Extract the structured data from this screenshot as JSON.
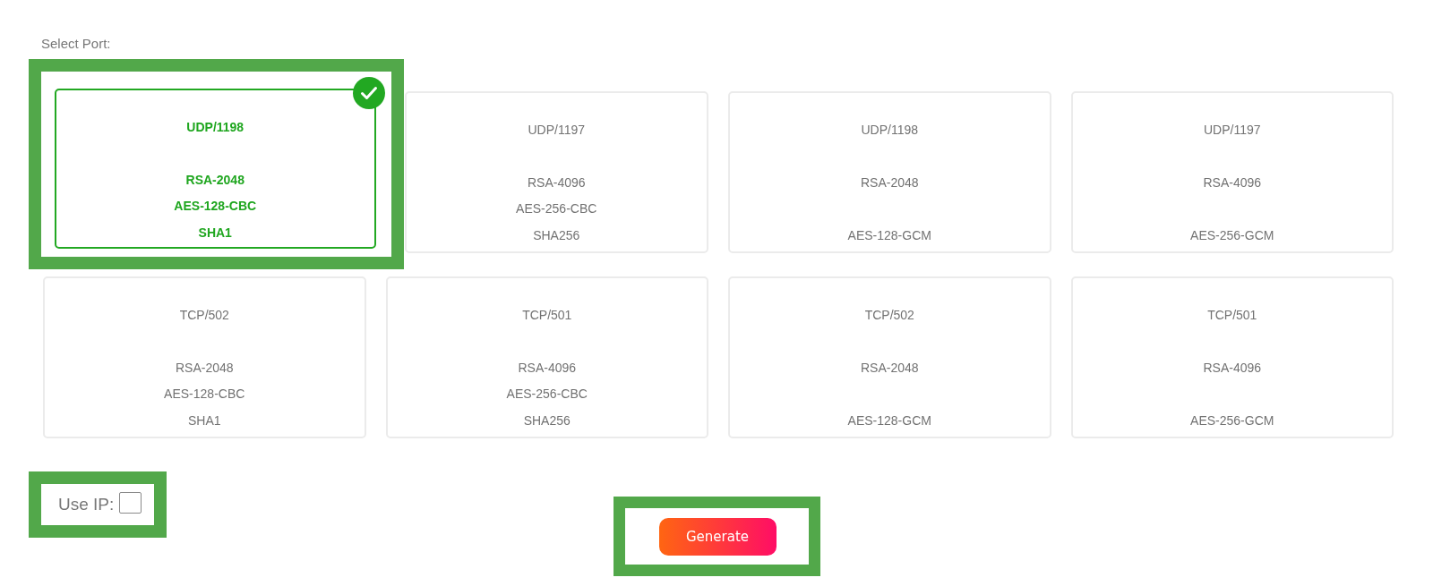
{
  "heading": "Select Port:",
  "ports": [
    {
      "port": "UDP/1198",
      "key": "RSA-2048",
      "cipher": "AES-128-CBC",
      "hash": "SHA1",
      "selected": true,
      "highlighted": true
    },
    {
      "port": "UDP/1197",
      "key": "RSA-4096",
      "cipher": "AES-256-CBC",
      "hash": "SHA256",
      "selected": false,
      "highlighted": false
    },
    {
      "port": "UDP/1198",
      "key": "RSA-2048",
      "cipher": "AES-128-GCM",
      "selected": false,
      "highlighted": false
    },
    {
      "port": "UDP/1197",
      "key": "RSA-4096",
      "cipher": "AES-256-GCM",
      "selected": false,
      "highlighted": false
    },
    {
      "port": "TCP/502",
      "key": "RSA-2048",
      "cipher": "AES-128-CBC",
      "hash": "SHA1",
      "selected": false,
      "highlighted": false
    },
    {
      "port": "TCP/501",
      "key": "RSA-4096",
      "cipher": "AES-256-CBC",
      "hash": "SHA256",
      "selected": false,
      "highlighted": false
    },
    {
      "port": "TCP/502",
      "key": "RSA-2048",
      "cipher": "AES-128-GCM",
      "selected": false,
      "highlighted": false
    },
    {
      "port": "TCP/501",
      "key": "RSA-4096",
      "cipher": "AES-256-GCM",
      "selected": false,
      "highlighted": false
    }
  ],
  "use_ip": {
    "label": "Use IP:",
    "checked": false,
    "highlighted": true
  },
  "generate_button": {
    "label": "Generate",
    "highlighted": true
  }
}
